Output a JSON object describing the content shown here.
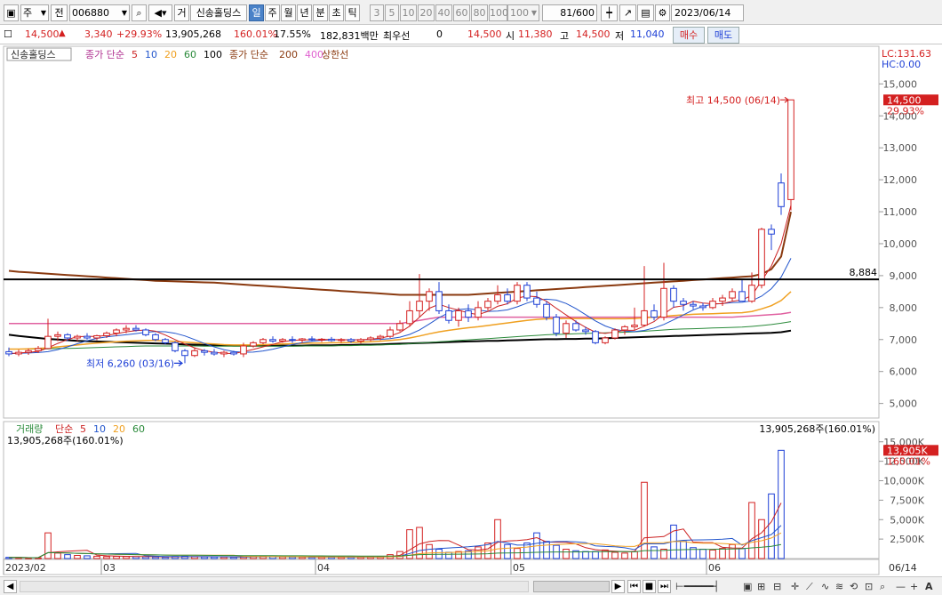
{
  "toolbar": {
    "type_select": "주",
    "prev_label": "전",
    "code": "006880",
    "trade_label": "거",
    "stock_name": "신송홀딩스",
    "period_tabs": [
      {
        "label": "일",
        "selected": true
      },
      {
        "label": "주",
        "selected": false
      },
      {
        "label": "월",
        "selected": false
      },
      {
        "label": "년",
        "selected": false
      },
      {
        "label": "분",
        "selected": false
      },
      {
        "label": "초",
        "selected": false
      },
      {
        "label": "틱",
        "selected": false
      }
    ],
    "interval_buttons": [
      "3",
      "5",
      "10",
      "20",
      "40",
      "60",
      "80",
      "100"
    ],
    "interval_select": "100",
    "count": "81",
    "total": "/600",
    "date": "2023/06/14"
  },
  "quote": {
    "price": "14,500",
    "change": "3,340",
    "change_pct": "+29.93%",
    "volume": "13,905,268",
    "volume_pct": "160.01%",
    "turnover": "17.55%",
    "amount": "182,831백만",
    "best_label": "최우선",
    "best_value": "0",
    "best_price": "14,500",
    "open_label": "시",
    "open": "11,380",
    "high_label": "고",
    "high": "14,500",
    "low_label": "저",
    "low": "11,040",
    "buy_button": "매수",
    "sell_button": "매도"
  },
  "legend": {
    "name": "신송홀딩스",
    "ma_title": "종가 단순",
    "ma_periods": [
      "5",
      "10",
      "20",
      "60",
      "100"
    ],
    "ma_long_title": "종가 단순",
    "ma_long_periods": [
      "200",
      "400"
    ],
    "limit_label": "상한선",
    "vol_title": "거래량",
    "vol_ma_title": "단순",
    "vol_ma_periods": [
      "5",
      "10",
      "20",
      "60"
    ],
    "vol_info_left": "13,905,268주(160.01%)",
    "vol_info_right": "13,905,268주(160.01%)"
  },
  "axis": {
    "lc": "LC:131.63",
    "hc": "HC:0.00",
    "price_ticks": [
      "15,000",
      "14,000",
      "13,000",
      "12,000",
      "11,000",
      "10,000",
      "9,000",
      "8,000",
      "7,000",
      "6,000",
      "5,000"
    ],
    "current_box": "14,500",
    "current_pct": "29.93%",
    "vol_ticks": [
      "15,000K",
      "12,500K",
      "10,000K",
      "7,500K",
      "5,000K",
      "2,500K"
    ],
    "vol_box": "13,905K",
    "vol_pct": "160.01%",
    "date_labels": [
      "2023/02",
      "03",
      "04",
      "05",
      "06"
    ],
    "last_date": "06/14"
  },
  "annotations": {
    "high_text": "최고 14,500 (06/14)",
    "low_text": "최저 6,260 (03/16)",
    "hline_value": "8,884"
  },
  "colors": {
    "up": "#d42020",
    "down": "#1d3fd6",
    "ma5": "#cc2222",
    "ma10": "#2255cc",
    "ma20": "#f0a020",
    "ma60": "#2a8a3a",
    "ma100": "#000000",
    "ma200": "#8a3a10",
    "ma400": "#e060d0",
    "limit": "#e060a0"
  },
  "chart_data": {
    "type": "candlestick",
    "price_range": [
      4600,
      15900
    ],
    "volume_range_k": [
      0,
      16000
    ],
    "hline": 8884,
    "candles": [
      {
        "o": 6620,
        "h": 6750,
        "l": 6480,
        "c": 6550
      },
      {
        "o": 6550,
        "h": 6680,
        "l": 6480,
        "c": 6600
      },
      {
        "o": 6600,
        "h": 6720,
        "l": 6520,
        "c": 6650
      },
      {
        "o": 6650,
        "h": 6800,
        "l": 6580,
        "c": 6720
      },
      {
        "o": 6720,
        "h": 7650,
        "l": 6700,
        "c": 7100
      },
      {
        "o": 7100,
        "h": 7250,
        "l": 6950,
        "c": 7150
      },
      {
        "o": 7150,
        "h": 7200,
        "l": 6950,
        "c": 7050
      },
      {
        "o": 7050,
        "h": 7150,
        "l": 6950,
        "c": 7100
      },
      {
        "o": 7100,
        "h": 7200,
        "l": 7000,
        "c": 7050
      },
      {
        "o": 7050,
        "h": 7150,
        "l": 6980,
        "c": 7120
      },
      {
        "o": 7120,
        "h": 7250,
        "l": 7050,
        "c": 7200
      },
      {
        "o": 7200,
        "h": 7350,
        "l": 7100,
        "c": 7300
      },
      {
        "o": 7300,
        "h": 7450,
        "l": 7200,
        "c": 7350
      },
      {
        "o": 7350,
        "h": 7450,
        "l": 7250,
        "c": 7300
      },
      {
        "o": 7300,
        "h": 7350,
        "l": 7100,
        "c": 7150
      },
      {
        "o": 7150,
        "h": 7200,
        "l": 6950,
        "c": 7000
      },
      {
        "o": 7000,
        "h": 7050,
        "l": 6850,
        "c": 6900
      },
      {
        "o": 6900,
        "h": 6950,
        "l": 6600,
        "c": 6650
      },
      {
        "o": 6650,
        "h": 6700,
        "l": 6260,
        "c": 6500
      },
      {
        "o": 6500,
        "h": 6750,
        "l": 6450,
        "c": 6650
      },
      {
        "o": 6650,
        "h": 6700,
        "l": 6500,
        "c": 6600
      },
      {
        "o": 6600,
        "h": 6700,
        "l": 6500,
        "c": 6550
      },
      {
        "o": 6550,
        "h": 6650,
        "l": 6450,
        "c": 6600
      },
      {
        "o": 6600,
        "h": 6650,
        "l": 6500,
        "c": 6550
      },
      {
        "o": 6550,
        "h": 6900,
        "l": 6450,
        "c": 6800
      },
      {
        "o": 6800,
        "h": 6950,
        "l": 6750,
        "c": 6900
      },
      {
        "o": 6900,
        "h": 7050,
        "l": 6850,
        "c": 7000
      },
      {
        "o": 7000,
        "h": 7100,
        "l": 6900,
        "c": 6950
      },
      {
        "o": 6950,
        "h": 7050,
        "l": 6900,
        "c": 7000
      },
      {
        "o": 7000,
        "h": 7100,
        "l": 6900,
        "c": 6980
      },
      {
        "o": 6980,
        "h": 7050,
        "l": 6900,
        "c": 7020
      },
      {
        "o": 7020,
        "h": 7100,
        "l": 6950,
        "c": 6990
      },
      {
        "o": 6990,
        "h": 7050,
        "l": 6920,
        "c": 7010
      },
      {
        "o": 7010,
        "h": 7080,
        "l": 6930,
        "c": 6970
      },
      {
        "o": 6970,
        "h": 7050,
        "l": 6900,
        "c": 7000
      },
      {
        "o": 7000,
        "h": 7050,
        "l": 6900,
        "c": 6950
      },
      {
        "o": 6950,
        "h": 7050,
        "l": 6880,
        "c": 7000
      },
      {
        "o": 7000,
        "h": 7100,
        "l": 6950,
        "c": 7050
      },
      {
        "o": 7050,
        "h": 7150,
        "l": 6980,
        "c": 7100
      },
      {
        "o": 7100,
        "h": 7400,
        "l": 7050,
        "c": 7300
      },
      {
        "o": 7300,
        "h": 7600,
        "l": 7250,
        "c": 7500
      },
      {
        "o": 7500,
        "h": 8200,
        "l": 7400,
        "c": 7900
      },
      {
        "o": 7900,
        "h": 9050,
        "l": 7700,
        "c": 8200
      },
      {
        "o": 8200,
        "h": 8600,
        "l": 7900,
        "c": 8500
      },
      {
        "o": 8500,
        "h": 8800,
        "l": 7800,
        "c": 7900
      },
      {
        "o": 7900,
        "h": 8100,
        "l": 7500,
        "c": 7600
      },
      {
        "o": 7600,
        "h": 8000,
        "l": 7400,
        "c": 7900
      },
      {
        "o": 7900,
        "h": 8100,
        "l": 7550,
        "c": 7700
      },
      {
        "o": 7700,
        "h": 8200,
        "l": 7600,
        "c": 8000
      },
      {
        "o": 8000,
        "h": 8300,
        "l": 7900,
        "c": 8200
      },
      {
        "o": 8200,
        "h": 8700,
        "l": 8100,
        "c": 8400
      },
      {
        "o": 8400,
        "h": 8600,
        "l": 8100,
        "c": 8200
      },
      {
        "o": 8200,
        "h": 8800,
        "l": 8100,
        "c": 8700
      },
      {
        "o": 8700,
        "h": 8800,
        "l": 8200,
        "c": 8300
      },
      {
        "o": 8300,
        "h": 8500,
        "l": 8000,
        "c": 8100
      },
      {
        "o": 8100,
        "h": 8200,
        "l": 7600,
        "c": 7700
      },
      {
        "o": 7700,
        "h": 7800,
        "l": 7100,
        "c": 7200
      },
      {
        "o": 7200,
        "h": 7600,
        "l": 7050,
        "c": 7500
      },
      {
        "o": 7500,
        "h": 7600,
        "l": 7250,
        "c": 7300
      },
      {
        "o": 7300,
        "h": 7400,
        "l": 7150,
        "c": 7250
      },
      {
        "o": 7250,
        "h": 7300,
        "l": 6850,
        "c": 6900
      },
      {
        "o": 6900,
        "h": 7100,
        "l": 6850,
        "c": 7050
      },
      {
        "o": 7050,
        "h": 7350,
        "l": 7000,
        "c": 7300
      },
      {
        "o": 7300,
        "h": 7450,
        "l": 7150,
        "c": 7400
      },
      {
        "o": 7400,
        "h": 8000,
        "l": 7300,
        "c": 7450
      },
      {
        "o": 7450,
        "h": 9300,
        "l": 7400,
        "c": 7900
      },
      {
        "o": 7900,
        "h": 8100,
        "l": 7600,
        "c": 7700
      },
      {
        "o": 7700,
        "h": 9400,
        "l": 7600,
        "c": 8600
      },
      {
        "o": 8600,
        "h": 8700,
        "l": 8000,
        "c": 8200
      },
      {
        "o": 8200,
        "h": 8300,
        "l": 7900,
        "c": 8100
      },
      {
        "o": 8100,
        "h": 8200,
        "l": 7950,
        "c": 8050
      },
      {
        "o": 8050,
        "h": 8150,
        "l": 7900,
        "c": 8000
      },
      {
        "o": 8000,
        "h": 8300,
        "l": 7950,
        "c": 8200
      },
      {
        "o": 8200,
        "h": 8400,
        "l": 8050,
        "c": 8300
      },
      {
        "o": 8300,
        "h": 8600,
        "l": 8200,
        "c": 8500
      },
      {
        "o": 8500,
        "h": 8900,
        "l": 8300,
        "c": 8200
      },
      {
        "o": 8200,
        "h": 9100,
        "l": 8150,
        "c": 8700
      },
      {
        "o": 8700,
        "h": 10500,
        "l": 8600,
        "c": 10450
      },
      {
        "o": 10450,
        "h": 10600,
        "l": 9800,
        "c": 10300
      },
      {
        "o": 11900,
        "h": 12200,
        "l": 10900,
        "c": 11160
      },
      {
        "o": 11380,
        "h": 14500,
        "l": 11040,
        "c": 14500
      }
    ],
    "volume_k": [
      150,
      120,
      90,
      100,
      3300,
      700,
      500,
      400,
      350,
      300,
      250,
      280,
      260,
      240,
      220,
      200,
      180,
      260,
      300,
      240,
      210,
      200,
      190,
      180,
      240,
      260,
      280,
      230,
      210,
      200,
      190,
      180,
      200,
      190,
      185,
      180,
      190,
      210,
      250,
      500,
      900,
      3700,
      4000,
      1800,
      1200,
      800,
      900,
      1000,
      1500,
      2000,
      5000,
      1800,
      1300,
      2000,
      3300,
      2200,
      1700,
      1200,
      1000,
      900,
      900,
      1100,
      800,
      700,
      900,
      9800,
      1500,
      1200,
      4300,
      2200,
      1400,
      1200,
      1100,
      1300,
      1800,
      1300,
      7200,
      5000,
      8300,
      13905
    ],
    "ma5": [
      6560,
      6580,
      6600,
      6630,
      6740,
      6880,
      7000,
      7090,
      7100,
      7100,
      7130,
      7180,
      7240,
      7280,
      7300,
      7260,
      7140,
      7000,
      6860,
      6740,
      6650,
      6600,
      6570,
      6560,
      6620,
      6690,
      6770,
      6850,
      6930,
      6970,
      6990,
      6990,
      7000,
      7000,
      6990,
      6990,
      6990,
      7010,
      7040,
      7110,
      7220,
      7420,
      7700,
      7980,
      8100,
      8000,
      7920,
      7830,
      7780,
      7880,
      8040,
      8120,
      8300,
      8360,
      8340,
      8200,
      7980,
      7770,
      7560,
      7380,
      7230,
      7190,
      7240,
      7290,
      7290,
      7420,
      7560,
      7800,
      8010,
      8060,
      8200,
      8140,
      8120,
      8120,
      8200,
      8240,
      8380,
      8840,
      9300,
      10000,
      11200
    ],
    "ma20": [
      6700,
      6700,
      6710,
      6720,
      6740,
      6770,
      6800,
      6830,
      6860,
      6890,
      6910,
      6930,
      6950,
      6960,
      6970,
      6970,
      6960,
      6940,
      6920,
      6900,
      6880,
      6860,
      6840,
      6830,
      6830,
      6830,
      6840,
      6850,
      6860,
      6870,
      6880,
      6890,
      6890,
      6900,
      6900,
      6910,
      6920,
      6930,
      6950,
      6970,
      7000,
      7050,
      7110,
      7180,
      7240,
      7290,
      7330,
      7370,
      7400,
      7440,
      7480,
      7520,
      7560,
      7600,
      7630,
      7650,
      7650,
      7660,
      7660,
      7660,
      7650,
      7650,
      7650,
      7650,
      7660,
      7680,
      7700,
      7720,
      7750,
      7770,
      7790,
      7800,
      7810,
      7820,
      7830,
      7840,
      7880,
      7960,
      8060,
      8220,
      8500
    ],
    "ma60": [
      6700,
      6700,
      6700,
      6710,
      6710,
      6720,
      6720,
      6730,
      6740,
      6750,
      6760,
      6770,
      6780,
      6790,
      6800,
      6800,
      6800,
      6800,
      6800,
      6800,
      6790,
      6790,
      6790,
      6790,
      6790,
      6790,
      6790,
      6790,
      6790,
      6790,
      6800,
      6800,
      6800,
      6800,
      6810,
      6810,
      6820,
      6820,
      6830,
      6840,
      6850,
      6870,
      6890,
      6910,
      6930,
      6950,
      6970,
      6990,
      7010,
      7030,
      7050,
      7070,
      7090,
      7110,
      7130,
      7150,
      7160,
      7170,
      7180,
      7190,
      7200,
      7210,
      7220,
      7230,
      7240,
      7260,
      7280,
      7300,
      7320,
      7330,
      7340,
      7350,
      7360,
      7370,
      7380,
      7390,
      7410,
      7440,
      7470,
      7510,
      7560
    ],
    "ma100": [
      7150,
      7110,
      7080,
      7050,
      7020,
      7000,
      6980,
      6960,
      6950,
      6940,
      6930,
      6920,
      6910,
      6900,
      6890,
      6880,
      6870,
      6860,
      6850,
      6840,
      6830,
      6820,
      6820,
      6810,
      6810,
      6810,
      6810,
      6810,
      6810,
      6810,
      6810,
      6820,
      6820,
      6820,
      6830,
      6830,
      6840,
      6840,
      6850,
      6860,
      6870,
      6880,
      6890,
      6900,
      6910,
      6920,
      6930,
      6940,
      6950,
      6960,
      6960,
      6970,
      6980,
      6990,
      7000,
      7010,
      7010,
      7020,
      7020,
      7030,
      7030,
      7040,
      7050,
      7060,
      7070,
      7080,
      7090,
      7100,
      7110,
      7120,
      7130,
      7140,
      7150,
      7160,
      7170,
      7180,
      7190,
      7200,
      7210,
      7230,
      7280
    ],
    "ma200": [
      9150,
      9120,
      9100,
      9080,
      9060,
      9040,
      9020,
      9000,
      8980,
      8960,
      8940,
      8920,
      8900,
      8880,
      8860,
      8840,
      8830,
      8820,
      8810,
      8800,
      8790,
      8780,
      8760,
      8740,
      8720,
      8700,
      8680,
      8660,
      8640,
      8620,
      8600,
      8580,
      8560,
      8540,
      8520,
      8500,
      8480,
      8460,
      8440,
      8420,
      8400,
      8400,
      8400,
      8400,
      8400,
      8400,
      8400,
      8400,
      8420,
      8440,
      8460,
      8480,
      8500,
      8520,
      8540,
      8560,
      8580,
      8600,
      8620,
      8640,
      8660,
      8680,
      8700,
      8720,
      8740,
      8760,
      8780,
      8800,
      8820,
      8840,
      8860,
      8880,
      8900,
      8920,
      8940,
      8960,
      8980,
      9050,
      9200,
      9600,
      11000
    ],
    "limit_line": [
      7500,
      7500,
      7500,
      7500,
      7500,
      7500,
      7500,
      7500,
      7500,
      7500,
      7500,
      7500,
      7500,
      7500,
      7500,
      7500,
      7500,
      7500,
      7500,
      7500,
      7500,
      7500,
      7500,
      7500,
      7500,
      7500,
      7500,
      7500,
      7500,
      7500,
      7500,
      7500,
      7500,
      7500,
      7500,
      7500,
      7500,
      7500,
      7500,
      7500,
      7500,
      7550,
      7600,
      7650,
      7700,
      7700,
      7700,
      7700,
      7700,
      7700,
      7700,
      7700,
      7700,
      7700,
      7700,
      7700,
      7700,
      7700,
      7700,
      7700,
      7700,
      7700,
      7700,
      7700,
      7700,
      7700,
      7700,
      7700,
      7700,
      7700,
      7700,
      7700,
      7700,
      7700,
      7700,
      7720,
      7740,
      7760,
      7780,
      7800,
      7850
    ]
  }
}
